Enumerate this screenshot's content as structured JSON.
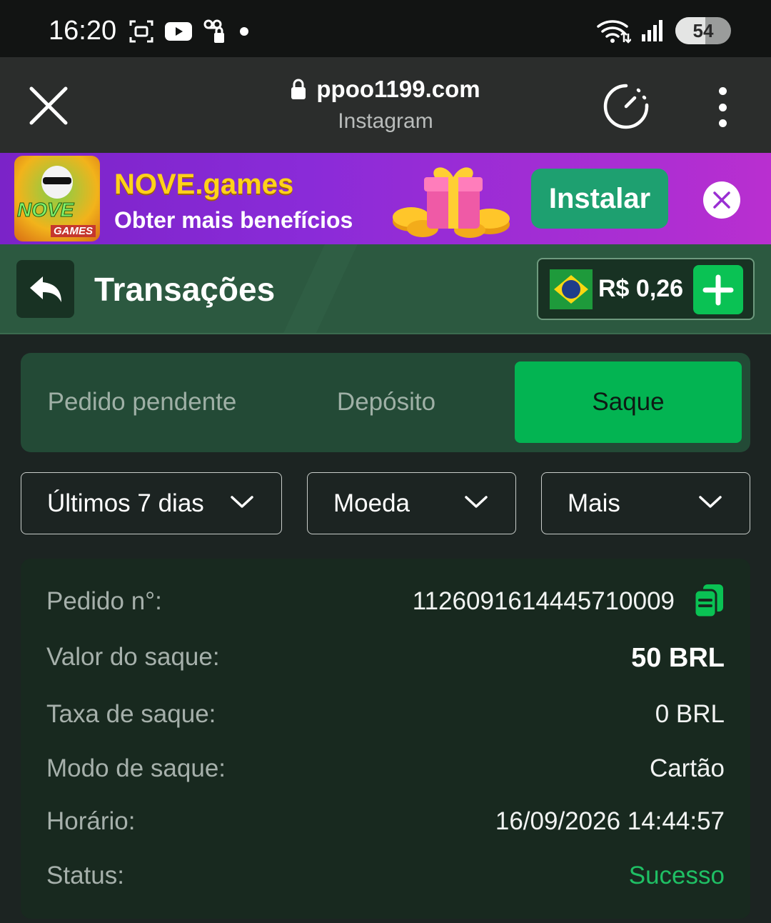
{
  "status_bar": {
    "time": "16:20",
    "battery": "54"
  },
  "browser": {
    "url": "ppoo1199.com",
    "source": "Instagram"
  },
  "promo": {
    "title": "NOVE.games",
    "subtitle": "Obter mais benefícios",
    "logo_top": "NOVE",
    "logo_bottom": "GAMES",
    "install_label": "Instalar"
  },
  "header": {
    "title": "Transações",
    "balance": "R$ 0,26"
  },
  "tabs": [
    {
      "label": "Pedido pendente",
      "active": false
    },
    {
      "label": "Depósito",
      "active": false
    },
    {
      "label": "Saque",
      "active": true
    }
  ],
  "filters": [
    {
      "label": "Últimos 7 dias"
    },
    {
      "label": "Moeda"
    },
    {
      "label": "Mais"
    }
  ],
  "details": {
    "order_label": "Pedido n°:",
    "order_value": "1126091614445710009",
    "amount_label": "Valor do saque:",
    "amount_value": "50 BRL",
    "fee_label": "Taxa de saque:",
    "fee_value": "0 BRL",
    "mode_label": "Modo de saque:",
    "mode_value": "Cartão",
    "time_label": "Horário:",
    "time_value": "16/09/2026 14:44:57",
    "status_label": "Status:",
    "status_value": "Sucesso"
  },
  "colors": {
    "accent_green": "#03b452",
    "success_text": "#1fbf64",
    "promo_purple": "#8a2bd8",
    "header_green": "#2c5940"
  }
}
